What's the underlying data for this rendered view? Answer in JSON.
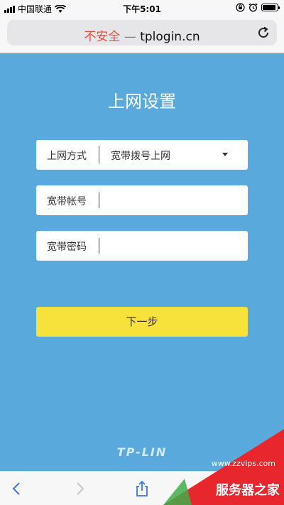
{
  "status_bar": {
    "carrier": "中国联通",
    "time": "下午5:01",
    "battery_level": 0.9
  },
  "address_bar": {
    "insecure_label": "不安全",
    "separator": " — ",
    "domain": "tplogin.cn"
  },
  "page": {
    "title": "上网设置",
    "fields": {
      "connection_type": {
        "label": "上网方式",
        "value": "宽带拨号上网"
      },
      "account": {
        "label": "宽带帐号",
        "value": ""
      },
      "password": {
        "label": "宽带密码",
        "value": ""
      }
    },
    "next_button": "下一步",
    "brand": "TP-LIN"
  },
  "watermark": {
    "url": "www.zzvips.com",
    "text": "服务器之家"
  },
  "colors": {
    "background": "#5aa9dc",
    "button": "#f6e23b",
    "insecure": "#e74c3c",
    "watermark": "#e8262d"
  },
  "icons": [
    "wifi-icon",
    "lock-rotation-icon",
    "alarm-icon",
    "battery-icon",
    "reload-icon",
    "back-icon",
    "forward-icon",
    "share-icon"
  ]
}
